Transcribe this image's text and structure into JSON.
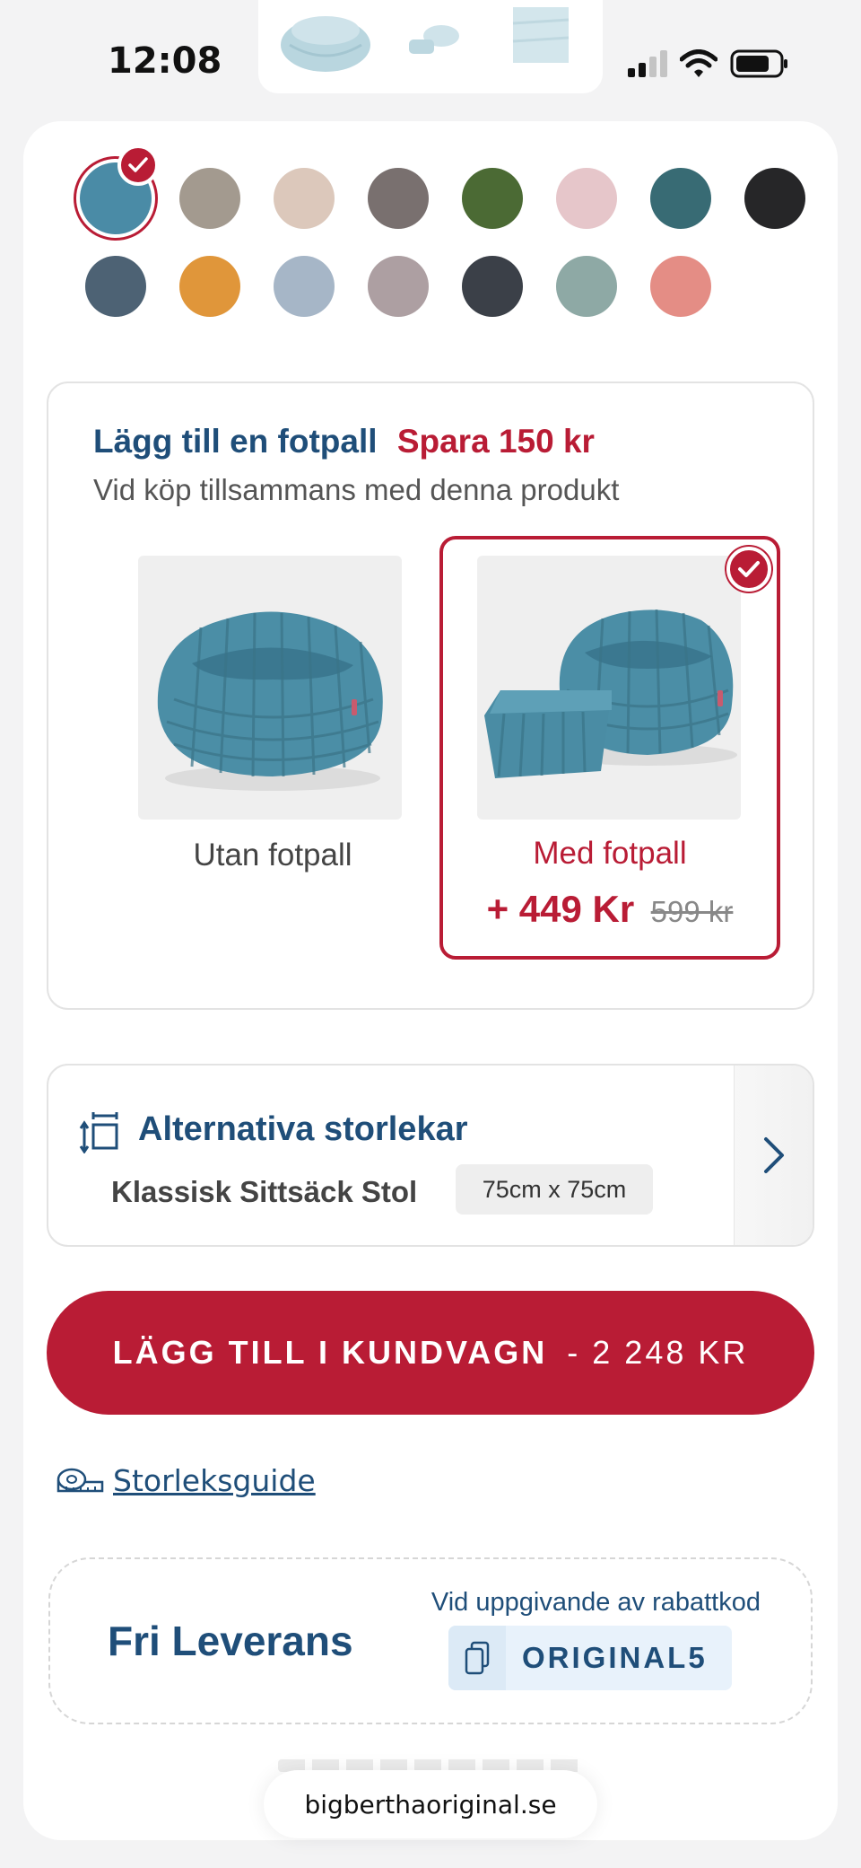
{
  "status_bar": {
    "time": "12:08"
  },
  "swatches": [
    {
      "color": "#4a8ba6",
      "selected": true
    },
    {
      "color": "#a39a8f"
    },
    {
      "color": "#dcc8bb"
    },
    {
      "color": "#79706f"
    },
    {
      "color": "#4b6a34"
    },
    {
      "color": "#e6c6ca"
    },
    {
      "color": "#386b74"
    },
    {
      "color": "#262628"
    },
    {
      "color": "#4d6274"
    },
    {
      "color": "#e0963a"
    },
    {
      "color": "#a6b6c7"
    },
    {
      "color": "#ad9fa2"
    },
    {
      "color": "#3b4048"
    },
    {
      "color": "#8ea9a5"
    },
    {
      "color": "#e48d85"
    }
  ],
  "footrest": {
    "title": "Lägg till en fotpall",
    "save": "Spara 150 kr",
    "subtitle": "Vid köp tillsammans med denna produkt",
    "options": [
      {
        "label": "Utan fotpall",
        "selected": false
      },
      {
        "label": "Med fotpall",
        "price_new": "+ 449 Kr",
        "price_old": "599 kr",
        "selected": true
      }
    ]
  },
  "sizes": {
    "title": "Alternativa storlekar",
    "name": "Klassisk Sittsäck Stol",
    "dimensions": "75cm x 75cm"
  },
  "cart": {
    "label": "LÄGG TILL I KUNDVAGN",
    "price": "- 2 248 KR"
  },
  "size_guide": {
    "label": "Storleksguide"
  },
  "delivery": {
    "title": "Fri Leverans",
    "code_label": "Vid uppgivande av rabattkod",
    "code": "ORIGINAL5"
  },
  "browser": {
    "url": "bigberthaoriginal.se"
  },
  "colors": {
    "brand_red": "#b91c35",
    "brand_blue": "#1f4e79",
    "product_teal": "#4a8ba6"
  }
}
